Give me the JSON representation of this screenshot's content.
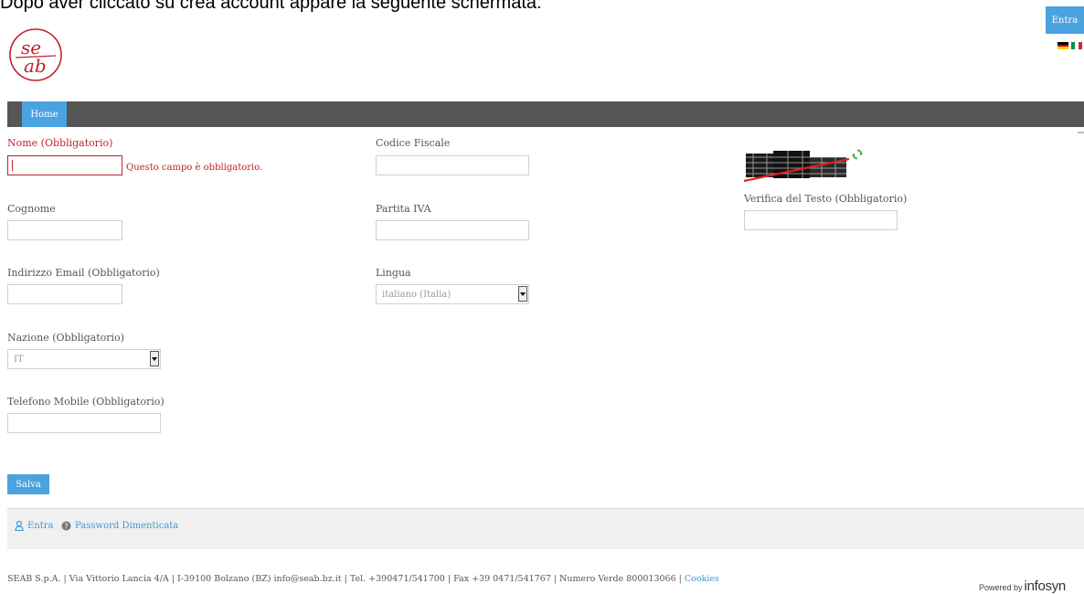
{
  "doc_caption": "Dopo aver cliccato su crea account appare la seguente schermata:",
  "header": {
    "login_label": "Entra",
    "logo_text": "seab",
    "colors": {
      "accent": "#4aa3df",
      "navbar": "#565656",
      "logo_red": "#c0222b"
    }
  },
  "nav": {
    "home_label": "Home"
  },
  "form": {
    "nome": {
      "label": "Nome (Obbligatorio)",
      "value": "",
      "error": "Questo campo è obbligatorio."
    },
    "cognome": {
      "label": "Cognome",
      "value": ""
    },
    "email": {
      "label": "Indirizzo Email (Obbligatorio)",
      "value": ""
    },
    "nazione": {
      "label": "Nazione (Obbligatorio)",
      "selected": "IT"
    },
    "telefono": {
      "label": "Telefono Mobile (Obbligatorio)",
      "value": ""
    },
    "codice_fiscale": {
      "label": "Codice Fiscale",
      "value": ""
    },
    "partita_iva": {
      "label": "Partita IVA",
      "value": ""
    },
    "lingua": {
      "label": "Lingua",
      "selected": "italiano (Italia)"
    },
    "verifica": {
      "label": "Verifica del Testo (Obbligatorio)",
      "value": ""
    },
    "save_label": "Salva"
  },
  "footer": {
    "login_link": "Entra",
    "forgot_password_link": "Password Dimenticata",
    "address": "SEAB S.p.A. | Via Vittorio Lancia 4/A | I-39100 Bolzano (BZ) info@seab.bz.it | Tel. +390471/541700 | Fax +39 0471/541767 | Numero Verde 800013066 |",
    "cookies_link": "Cookies",
    "powered_by": "Powered by",
    "powered_brand": "infosyn"
  },
  "icons": [
    "flag-de-icon",
    "flag-it-icon",
    "captcha-refresh-icon",
    "user-icon",
    "help-icon"
  ]
}
